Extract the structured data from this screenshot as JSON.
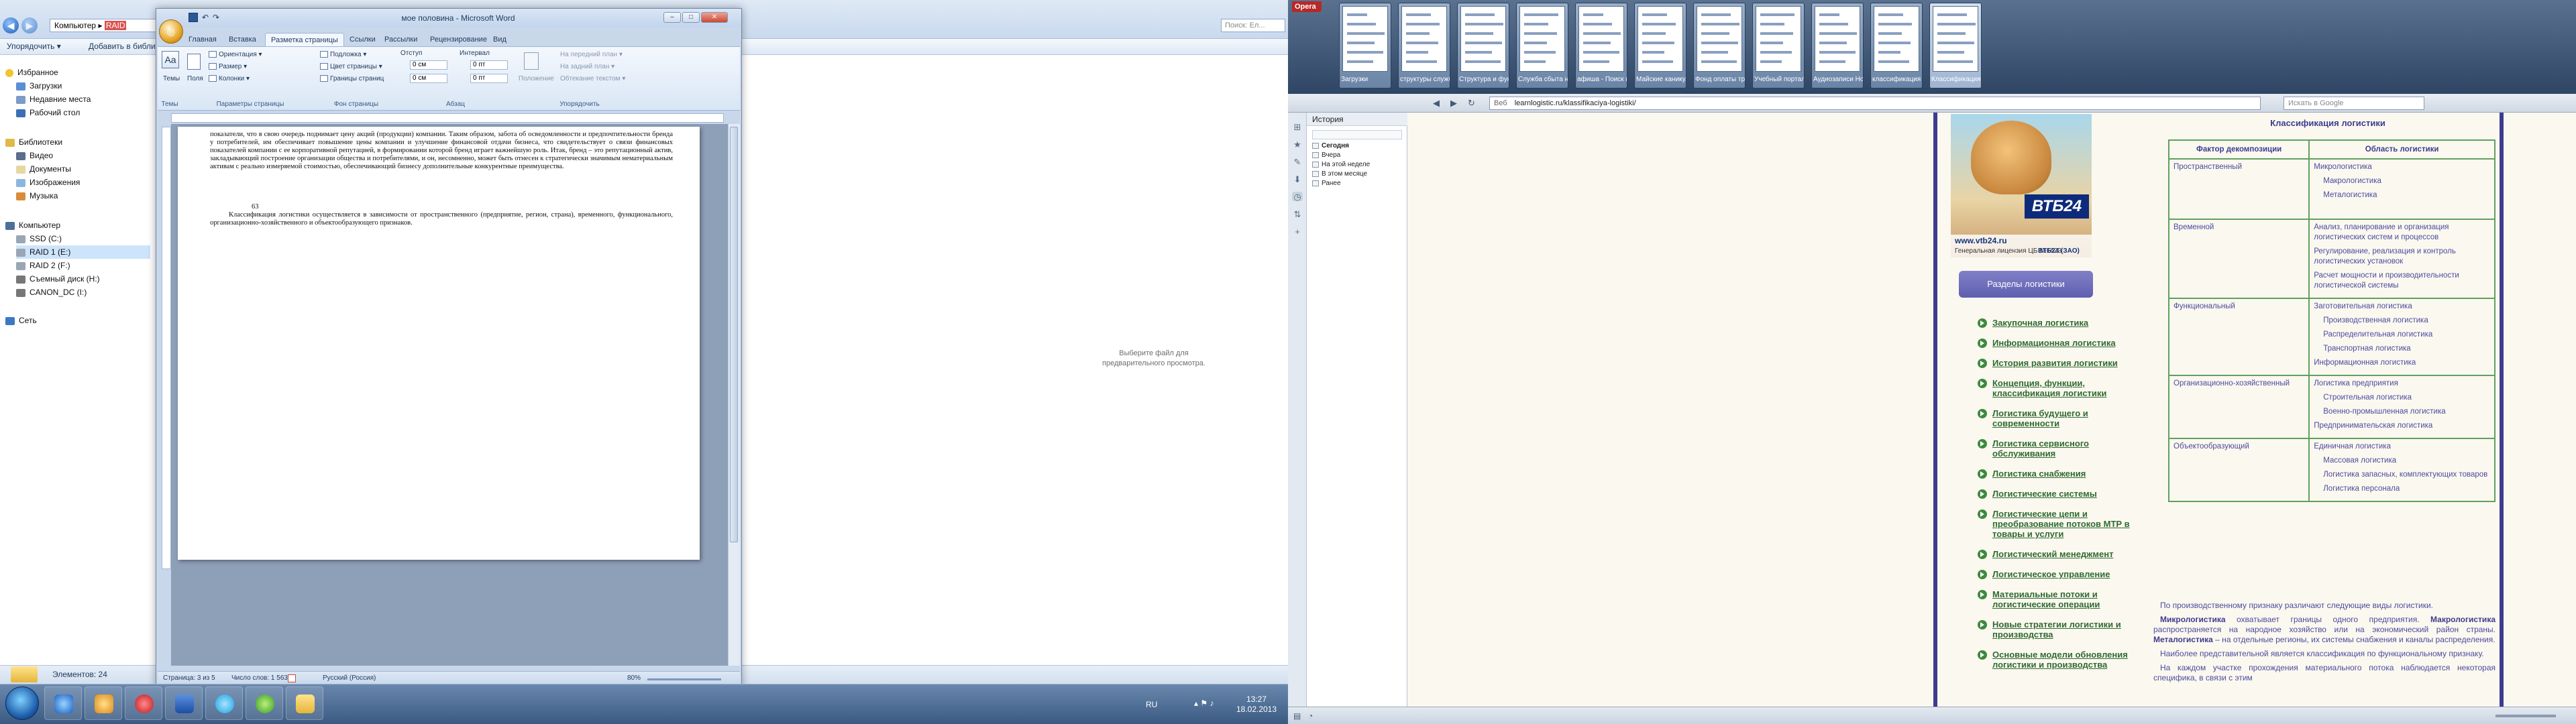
{
  "explorer": {
    "breadcrumb": [
      "Компьютер",
      "RAID"
    ],
    "search_placeholder": "Поиск: Ел...",
    "commands": [
      "Упорядочить ▾",
      "Добавить в библи"
    ],
    "favorites": [
      "Избранное",
      "Загрузки",
      "Недавние места",
      "Рабочий стол"
    ],
    "libraries": [
      "Библиотеки",
      "Видео",
      "Документы",
      "Изображения",
      "Музыка"
    ],
    "computer": [
      "Компьютер",
      "SSD (C:)",
      "RAID 1 (E:)",
      "RAID 2 (F:)",
      "Съемный диск (H:)",
      "CANON_DC (I:)"
    ],
    "network": "Сеть",
    "preview_text": "Выберите файл для предварительного просмотра.",
    "item_count": "Элементов: 24"
  },
  "word": {
    "title": "мое половина - Microsoft Word",
    "tabs": [
      "Главная",
      "Вставка",
      "Разметка страницы",
      "Ссылки",
      "Рассылки",
      "Рецензирование",
      "Вид"
    ],
    "active_tab": "Разметка страницы",
    "ribbon": {
      "themes_btn": "Темы",
      "fields_btn": "Поля",
      "orientation": "Ориентация ▾",
      "size": "Размер ▾",
      "columns": "Колонки ▾",
      "watermark": "Подложка ▾",
      "page_color": "Цвет страницы ▾",
      "page_borders": "Границы страниц",
      "indent_label": "Отступ",
      "indent_left": "0 см",
      "indent_right": "0 см",
      "spacing_label": "Интервал",
      "spacing_before": "0 пт",
      "spacing_after": "0 пт",
      "position": "Положение",
      "bring_front": "На передний план ▾",
      "send_back": "На задний план ▾",
      "wrap": "Обтекание текстом ▾",
      "groups": [
        "Темы",
        "Параметры страницы",
        "Фон страницы",
        "Абзац",
        "Упорядочить"
      ]
    },
    "doc_paragraphs": [
      "показатели, что в свою очередь поднимает цену акций (продукции) компании. Таким образом, забота об осведомленности и предпочтительности бренда у потребителей, им обеспечивает повышение цены компании и улучшение финансовой отдачи бизнеса, что свидетельствует о связи финансовых показателей компании с ее корпоративной репутацией, в формировании которой бренд играет важнейшую роль. Итак, бренд – это репутационный актив, закладывающий построение организации общества и потребителями, и он, несомненно, может быть отнесен к стратегически значимым нематериальным активам с реально измеряемой стоимостью, обеспечивающий бизнесу дополнительные конкурентные преимущества.",
      "63",
      "Классификация логистики осуществляется в зависимости от пространственного (предприятие, регион, страна), временного, функционального, организационно-хозяйственного и объектообразующего признаков."
    ],
    "status": {
      "page": "Страница: 3 из 5",
      "words": "Число слов: 1 563",
      "lang": "Русский (Россия)",
      "zoom": "80%"
    }
  },
  "opera": {
    "menu": "Opera",
    "tabs": [
      {
        "label": "Загрузки"
      },
      {
        "label": "структуры служб..."
      },
      {
        "label": "Структура и фун..."
      },
      {
        "label": "Служба сбыта на..."
      },
      {
        "label": "афиша - Поиск в..."
      },
      {
        "label": "Майские каникул..."
      },
      {
        "label": "Фонд оплаты тру..."
      },
      {
        "label": "Учебный портал ..."
      },
      {
        "label": "Аудиозаписи Нов..."
      },
      {
        "label": "классификация л..."
      },
      {
        "label": "Классификация л..."
      }
    ],
    "url_prefix": "Веб",
    "url": "learnlogistic.ru/klassifikaciya-logistiki/",
    "google_search": "Искать в Google",
    "history": {
      "title": "История",
      "items": [
        "Сегодня",
        "Вчера",
        "На этой неделе",
        "В этом месяце",
        "Ранее"
      ]
    }
  },
  "site": {
    "banner": {
      "bank": "ВТБ24",
      "url": "www.vtb24.ru",
      "license": "Генеральная лицензия ЦБ №1623",
      "zao": "ВТБ24 (ЗАО)"
    },
    "sections_title": "Разделы логистики",
    "menu": [
      "Закупочная логистика",
      "Информационная логистика",
      "История развития логистики",
      "Концепция, функции, классификация логистики",
      "Логистика будущего и современности",
      "Логистика сервисного обслуживания",
      "Логистика снабжения",
      "Логистические системы",
      "Логистические цепи и преобразование потоков МТР в товары и услуги",
      "Логистический менеджмент",
      "Логистическое управление",
      "Материальные потоки и логистические операции",
      "Новые стратегии логистики и производства",
      "Основные модели обновления логистики и производства"
    ],
    "table": {
      "title": "Классификация логистики",
      "headers": [
        "Фактор декомпозиции",
        "Область логистики"
      ],
      "rows": [
        {
          "factor": "Пространственный",
          "areas": [
            "Микрологистика",
            "Макрологистика",
            "Металогистика"
          ]
        },
        {
          "factor": "Временной",
          "areas": [
            "Анализ, планирование и организация логистических систем и процессов",
            "Регулирование, реализация и контроль логистических установок",
            "Расчет мощности и производительности логистической системы"
          ]
        },
        {
          "factor": "Функциональный",
          "areas": [
            "Заготовительная логистика",
            "Производственная логистика",
            "Распределительная логистика",
            "Транспортная логистика",
            "Информационная логистика"
          ]
        },
        {
          "factor": "Организационно-хозяйственный",
          "areas": [
            "Логистика предприятия",
            "Строительная логистика",
            "Военно-промышленная логистика",
            "Предпринимательская логистика"
          ]
        },
        {
          "factor": "Объектообразующий",
          "areas": [
            "Единичная логистика",
            "Массовая логистика",
            "Логистика запасных, комплектующих товаров",
            "Логистика персонала"
          ]
        }
      ]
    },
    "paragraphs": {
      "p1": "По производственному признаку различают следующие виды логистики.",
      "p2_b1": "Микрологистика",
      "p2_t1": " охватывает границы одного предприятия. ",
      "p2_b2": "Макрологистика",
      "p2_t2": " распространяется на народное хозяйство или на экономический район страны. ",
      "p2_b3": "Металогистика",
      "p2_t3": " – на отдельные регионы, их системы снабжения и каналы распределения.",
      "p3": "Наиболее представительной является классификация по функциональному признаку.",
      "p4": "На каждом участке прохождения материального потока наблюдается некоторая специфика, в связи с этим"
    }
  },
  "taskbar": {
    "lang": "RU",
    "time": "13:27",
    "date": "18.02.2013"
  },
  "colors": {
    "site_accent": "#3d3c8e",
    "table_border": "#5fa05f",
    "menu_link": "#2f6b2f",
    "word_chrome": "#c9d7ea"
  }
}
